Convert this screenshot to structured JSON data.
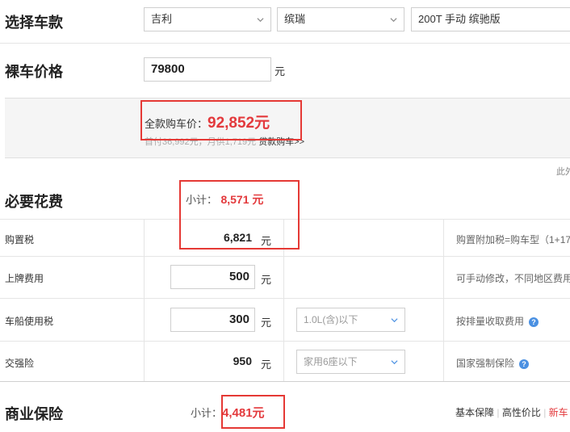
{
  "select_car": {
    "title": "选择车款",
    "brand": "吉利",
    "series": "缤瑞",
    "model": "200T 手动 缤驰版"
  },
  "bare_price": {
    "title": "裸车价格",
    "value": "79800",
    "unit": "元"
  },
  "full_price": {
    "label": "全款购车价：",
    "value": "92,852元",
    "sub_text": "首付36,992元，月供1,719元",
    "loan_link": "贷款购车>>",
    "edge_text": "此外"
  },
  "necessary": {
    "title": "必要花费",
    "subtotal_label": "小计：",
    "subtotal_value": "8,571 元",
    "rows": [
      {
        "label": "购置税",
        "value": "6,821",
        "unit": "元",
        "note": "购置附加税=购车型（1+17"
      },
      {
        "label": "上牌费用",
        "value": "500",
        "unit": "元",
        "note": "可手动修改，不同地区费用"
      },
      {
        "label": "车船使用税",
        "value": "300",
        "unit": "元",
        "select": "1.0L(含)以下",
        "note": "按排量收取费用"
      },
      {
        "label": "交强险",
        "value": "950",
        "unit": "元",
        "select": "家用6座以下",
        "note": "国家强制保险"
      }
    ]
  },
  "commercial": {
    "title": "商业保险",
    "subtotal_label": "小计：",
    "subtotal_value": "4,481元",
    "tabs": [
      "基本保障",
      "高性价比",
      "新车"
    ]
  },
  "colors": {
    "accent_red": "#e3393c",
    "box_red": "#e53935",
    "help_blue": "#4a90e2"
  }
}
